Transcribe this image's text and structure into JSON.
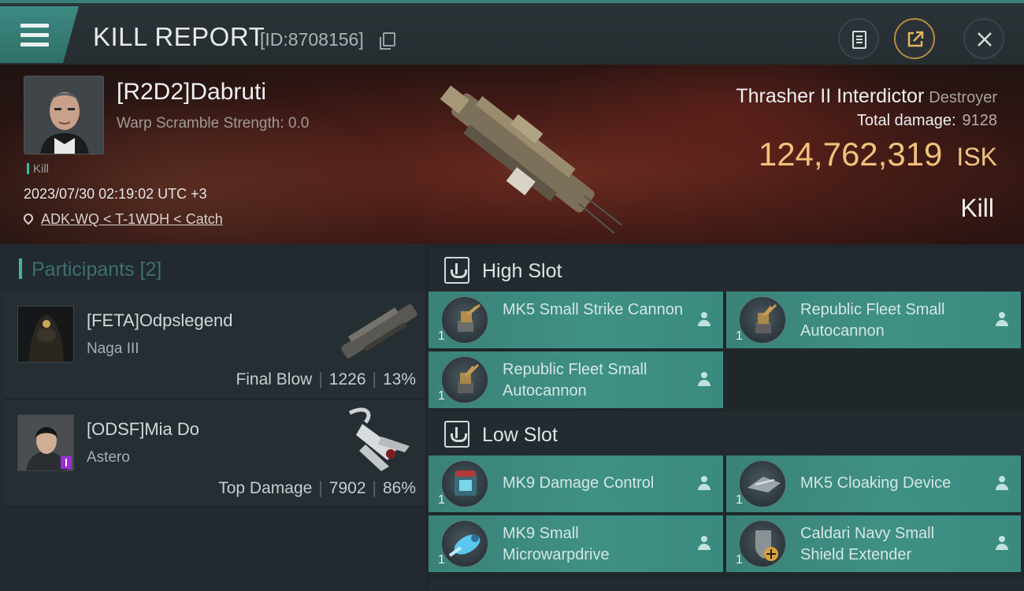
{
  "header": {
    "title": "KILL REPORT",
    "report_id": "[ID:8708156]"
  },
  "victim": {
    "name": "[R2D2]Dabruti",
    "warp_scramble": "Warp Scramble Strength: 0.0",
    "tag": "Kill",
    "date": "2023/07/30 02:19:02 UTC +3",
    "location": "ADK-WQ < T-1WDH < Catch",
    "ship_name": "Thrasher II Interdictor",
    "ship_class": "Destroyer",
    "damage_label": "Total damage:",
    "damage_value": "9128",
    "isk_value": "124,762,319",
    "isk_unit": "ISK",
    "result": "Kill"
  },
  "participants": {
    "title": "Participants [2]",
    "rows": [
      {
        "name": "[FETA]Odpslegend",
        "ship": "Naga III",
        "role": "Final Blow",
        "damage": "1226",
        "percent": "13%"
      },
      {
        "name": "[ODSF]Mia Do",
        "ship": "Astero",
        "role": "Top Damage",
        "damage": "7902",
        "percent": "86%"
      }
    ]
  },
  "slots": {
    "high": {
      "title": "High Slot",
      "modules": [
        {
          "name": "MK5 Small Strike Cannon",
          "qty": "1"
        },
        {
          "name": "Republic Fleet Small Autocannon",
          "qty": "1"
        },
        {
          "name": "Republic Fleet Small Autocannon",
          "qty": "1"
        }
      ]
    },
    "low": {
      "title": "Low Slot",
      "modules": [
        {
          "name": "MK9 Damage Control",
          "qty": "1"
        },
        {
          "name": "MK5 Cloaking Device",
          "qty": "1"
        },
        {
          "name": "MK9 Small Microwarpdrive",
          "qty": "1"
        },
        {
          "name": "Caldari Navy Small Shield Extender",
          "qty": "1"
        }
      ]
    }
  },
  "colors": {
    "accent": "#3fb6a8",
    "isk": "#f1c27a",
    "module_bg": "#3f9085"
  }
}
